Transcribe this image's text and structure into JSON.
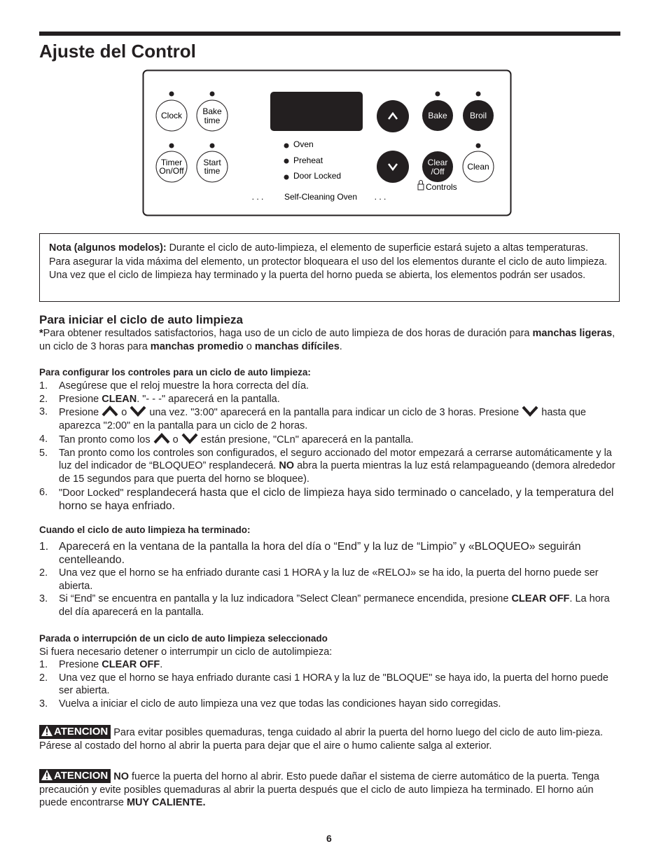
{
  "title": "Ajuste del Control",
  "panel": {
    "buttons": {
      "clock": "Clock",
      "bake_time": [
        "Bake",
        "time"
      ],
      "timer": [
        "Timer",
        "On/Off"
      ],
      "start_time": [
        "Start",
        "time"
      ],
      "bake": "Bake",
      "broil": "Broil",
      "clear_off": [
        "Clear",
        "/Off"
      ],
      "clean": "Clean"
    },
    "indicators": [
      "Oven",
      "Preheat",
      "Door Locked"
    ],
    "controls_label": "Controls",
    "footer": "Self-Cleaning Oven",
    "footer_dots": ". . .",
    "colors": {
      "button_fill": "#231f20",
      "display": "#231f20"
    }
  },
  "note": [
    {
      "t": "Nota (algunos modelos):",
      "b": true
    },
    {
      "t": " Durante el ciclo de auto-limpieza, el elemento de superficie estará sujeto a altas temperaturas. Para asegurar la vida máxima del elemento, un protector bloqueara el uso del los elementos durante el ciclo de auto limpieza. Una vez que el ciclo de limpieza hay terminado y la puerta del horno pueda se abierta, los elementos podrán ser usados."
    }
  ],
  "section1": {
    "heading": "Para iniciar el ciclo de auto limpieza",
    "intro": [
      {
        "t": "*",
        "b": true
      },
      {
        "t": "Para obtener resultados satisfactorios, haga uso de un ciclo de auto limpieza de dos horas de duración para "
      },
      {
        "t": "manchas ligeras",
        "b": true
      },
      {
        "t": ", un ciclo de 3 horas para "
      },
      {
        "t": "manchas promedio",
        "b": true
      },
      {
        "t": " o "
      },
      {
        "t": "manchas difíciles",
        "b": true
      },
      {
        "t": "."
      }
    ],
    "subheading": "Para configurar los controles para un ciclo de auto limpieza:",
    "steps": [
      [
        {
          "t": "Asegúrese que el reloj muestre la hora correcta del día."
        }
      ],
      [
        {
          "t": "Presione "
        },
        {
          "t": "CLEAN",
          "b": true
        },
        {
          "t": ". \"- - -\" aparecerá en la pantalla."
        }
      ],
      [
        {
          "t": "Presione "
        },
        {
          "icon": "up"
        },
        {
          "t": " o "
        },
        {
          "icon": "down"
        },
        {
          "t": " una vez. \"3:00\" aparecerá en la pantalla para indicar un ciclo de 3 horas. Presione "
        },
        {
          "icon": "down"
        },
        {
          "t": " hasta que aparezca \"2:00\" en la pantalla para un ciclo de 2 horas."
        }
      ],
      [
        {
          "t": "Tan pronto como los "
        },
        {
          "icon": "up"
        },
        {
          "t": " o "
        },
        {
          "icon": "down"
        },
        {
          "t": " están presione, \"CLn\" aparecerá en la pantalla."
        }
      ],
      [
        {
          "t": "Tan pronto como los controles son configurados, el seguro accionado del motor empezará a cerrarse automáticamente y la luz del indicador de “BLOQUEO” resplandecerá. "
        },
        {
          "t": "NO",
          "b": true
        },
        {
          "t": " abra la puerta mientras la luz está relampagueando (demora alrededor de 15 segundos para que puerta del horno se bloquee)."
        }
      ],
      [
        {
          "t": "\"Door Locked\""
        },
        {
          "t": " resplandecerá hasta que el ciclo de limpieza haya sido terminado o cancelado, y la temperatura del horno se haya enfriado.",
          "big": true
        }
      ]
    ]
  },
  "section2": {
    "subheading": "Cuando el ciclo de auto limpieza ha terminado:",
    "steps": [
      [
        {
          "t": "Aparecerá en la ventana de la pantalla la hora del día o “End” y la luz de  “Limpio” y «BLOQUEO» seguirán centelleando.",
          "big": true
        }
      ],
      [
        {
          "t": "Una vez que el horno se ha enfriado durante casi 1 HORA y la luz de «RELOJ» se ha ido, la puerta del horno puede ser abierta."
        }
      ],
      [
        {
          "t": "Si “End” se encuentra en pantalla y la luz indicadora ”Select Clean” permanece encendida, presione "
        },
        {
          "t": "CLEAR OFF",
          "b": true
        },
        {
          "t": ". La hora del día aparecerá en la pantalla."
        }
      ]
    ]
  },
  "section3": {
    "subheading": "Parada o interrupción de un ciclo de auto limpieza seleccionado",
    "intro": "Si fuera necesario detener o interrumpir un ciclo de autolimpieza:",
    "steps": [
      [
        {
          "t": "Presione "
        },
        {
          "t": "CLEAR OFF",
          "b": true
        },
        {
          "t": "."
        }
      ],
      [
        {
          "t": "Una vez que el horno se haya enfriado durante casi 1 HORA y la luz de \"BLOQUE\" se haya ido, la puerta del horno puede ser abierta."
        }
      ],
      [
        {
          "t": "Vuelva a iniciar el ciclo de auto limpieza una vez que todas las condiciones hayan sido corregidas."
        }
      ]
    ]
  },
  "warnings": [
    {
      "badge": "ATENCION",
      "text": [
        {
          "t": "Para evitar posibles quemaduras, tenga cuidado al abrir la puerta del horno luego del ciclo de auto lim-pieza. Párese al costado del horno al abrir la puerta para dejar que el aire o humo caliente salga al exterior."
        }
      ]
    },
    {
      "badge": "ATENCION",
      "text": [
        {
          "t": "NO",
          "b": true
        },
        {
          "t": " fuerce la puerta del horno al abrir. Esto puede dañar el sistema de cierre automático de la puerta. Tenga precaución y evite posibles quemaduras al abrir la puerta después que el ciclo de auto limpieza ha terminado. El horno aún puede encontrarse "
        },
        {
          "t": "MUY CALIENTE.",
          "b": true
        }
      ]
    }
  ],
  "page_number": "6"
}
